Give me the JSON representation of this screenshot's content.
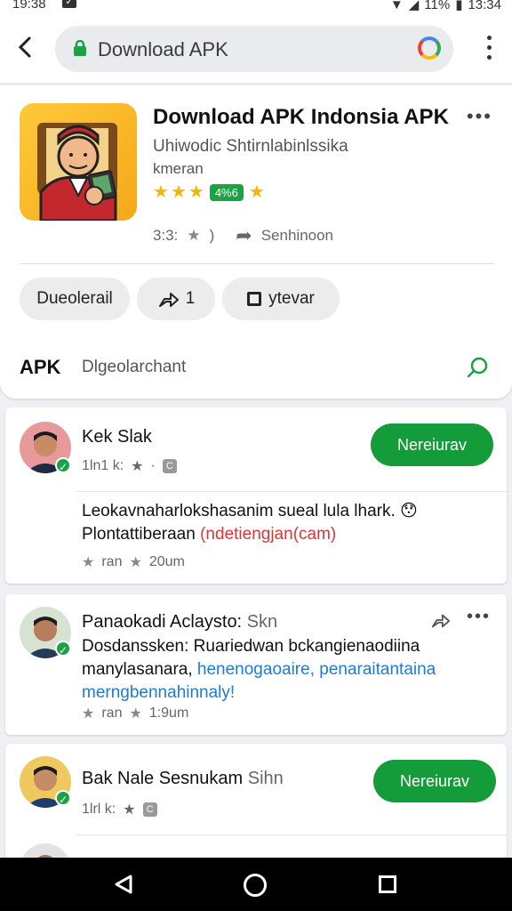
{
  "status": {
    "time": "19:38",
    "battery": "11%",
    "clock": "13:34"
  },
  "browser": {
    "url": "Download APK"
  },
  "app": {
    "title": "Download APK Indonsia APK",
    "developer": "Uhiwodic Shtirnlabinlssika",
    "category": "kmeran",
    "rating_badge": "4%6",
    "size": "3:3:",
    "share_label": "Senhinoon",
    "chips": {
      "download": "Dueolerail",
      "share_count": "1",
      "review": "ytevar"
    },
    "apk_label": "APK",
    "apk_desc": "Dlgeolarchant",
    "colors": {
      "accent": "#149b3a",
      "star": "#f2b705"
    }
  },
  "reviews": [
    {
      "name": "Kek Slak",
      "meta": "1ln1 k:",
      "follow": "Nereiurav",
      "line1": "Leokavnaharlokshasanim sueal lula lhark.",
      "line2a": "Plontattiberaan",
      "line2b": "(ndetiengjan(cam)",
      "foot_a": "ran",
      "foot_b": "20um"
    },
    {
      "name": "Panaokadi Aclaysto:",
      "name_suffix": "Skn",
      "line1": "Dosdanssken: Ruariedwan bckangienaodiina",
      "line2a": "manylasanara,",
      "line2b": "henenogaoaire, penaraitantaina",
      "line3": "merngbennahinnaly!",
      "foot_a": "ran",
      "foot_b": "1:9um"
    },
    {
      "name": "Bak Nale Sesnukam",
      "name_suffix": "Sihn",
      "meta": "1lrl k:",
      "follow": "Nereiurav"
    }
  ]
}
